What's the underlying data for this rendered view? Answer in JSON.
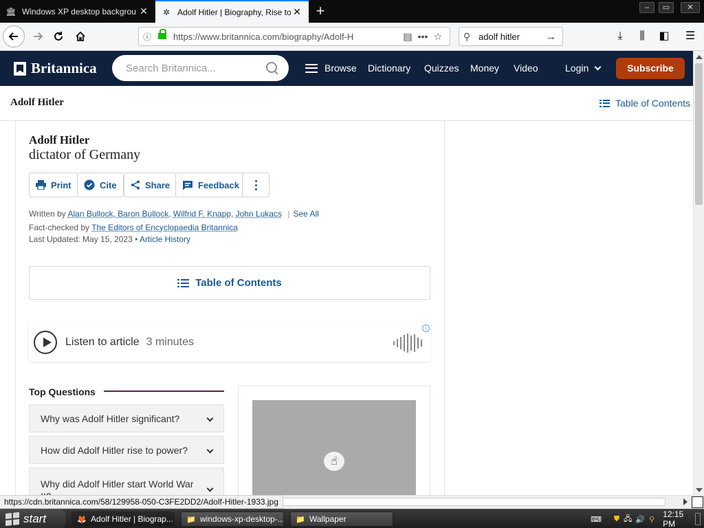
{
  "browser": {
    "tabs": [
      {
        "title": "Windows XP desktop backgrou",
        "icon": "museum-icon",
        "active": false
      },
      {
        "title": "Adolf Hitler | Biography, Rise to",
        "icon": "britannica-thistle-icon",
        "active": true
      }
    ],
    "new_tab": "+",
    "url": "https://www.britannica.com/biography/Adolf-H",
    "search_value": "adolf hitler",
    "window_controls": {
      "minimize": "–",
      "maximize": "▭",
      "close": "✕"
    }
  },
  "site": {
    "logo": "Britannica",
    "search_placeholder": "Search Britannica...",
    "nav": {
      "browse": "Browse",
      "dictionary": "Dictionary",
      "quizzes": "Quizzes",
      "money": "Money",
      "video": "Video",
      "login": "Login",
      "subscribe": "Subscribe"
    },
    "accent": "#b03c0c",
    "header_bg": "#10213d"
  },
  "sticky": {
    "title": "Adolf Hitler",
    "toc": "Table of Contents"
  },
  "article": {
    "title": "Adolf Hitler",
    "subtitle": "dictator of Germany",
    "actions": {
      "print": "Print",
      "cite": "Cite",
      "share": "Share",
      "feedback": "Feedback"
    },
    "byline": {
      "written_by": "Written by",
      "authors": [
        "Alan Bullock, Baron Bullock",
        "Wilfrid F. Knapp",
        "John Lukacs"
      ],
      "see_all": "See All",
      "fact_checked_by": "Fact-checked by",
      "fact_checker": "The Editors of Encyclopaedia Britannica",
      "last_updated": "Last Updated: May 15, 2023",
      "bullet": "•",
      "article_history": "Article History"
    },
    "toc_label": "Table of Contents",
    "listen": {
      "label": "Listen to article",
      "duration": "3 minutes"
    },
    "ad_marker": "i",
    "top_questions": {
      "heading": "Top Questions",
      "items": [
        "Why was Adolf Hitler significant?",
        "How did Adolf Hitler rise to power?",
        "Why did Adolf Hitler start World War II?"
      ]
    }
  },
  "status": {
    "hover_url": "https://cdn.britannica.com/58/129958-050-C3FE2DD2/Adolf-Hitler-1933.jpg"
  },
  "taskbar": {
    "start": "start",
    "tasks": [
      {
        "label": "Adolf Hitler | Biograp...",
        "icon": "firefox-icon",
        "active": true
      },
      {
        "label": "windows-xp-desktop-...",
        "icon": "folder-icon",
        "active": false
      },
      {
        "label": "Wallpaper",
        "icon": "folder-icon",
        "active": false
      }
    ],
    "clock": "12:15 PM"
  }
}
